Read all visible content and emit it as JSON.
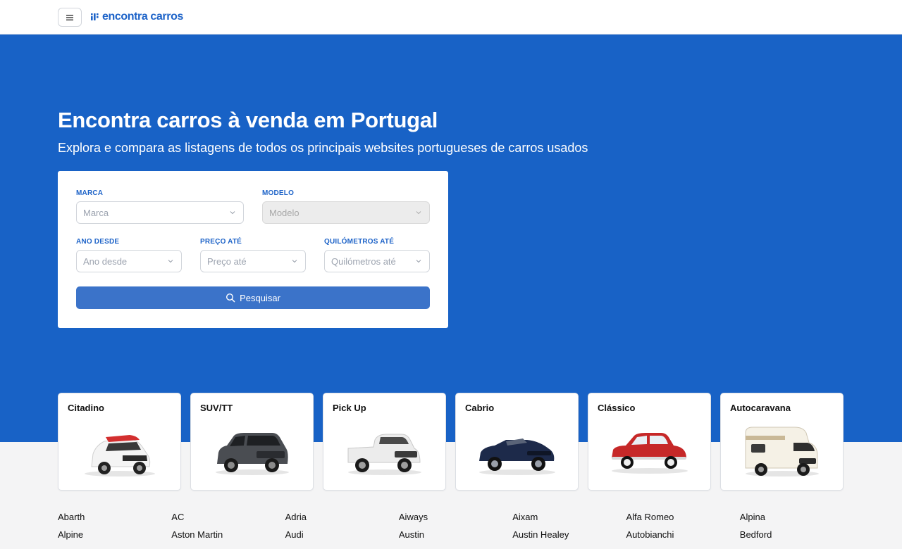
{
  "header": {
    "logo_text": "encontra carros",
    "menu_icon": "hamburger-icon",
    "brand_color": "#1d63c8"
  },
  "hero": {
    "title": "Encontra carros à venda em Portugal",
    "subtitle": "Explora e compara as listagens de todos os principais websites portugueses de carros usados",
    "background": "#1862c6"
  },
  "search": {
    "marca_label": "MARCA",
    "marca_placeholder": "Marca",
    "modelo_label": "MODELO",
    "modelo_placeholder": "Modelo",
    "ano_label": "ANO DESDE",
    "ano_placeholder": "Ano desde",
    "preco_label": "PREÇO ATÉ",
    "preco_placeholder": "Preço até",
    "km_label": "QUILÓMETROS ATÉ",
    "km_placeholder": "Quilómetros até",
    "button_label": "Pesquisar"
  },
  "categories": [
    {
      "label": "Citadino",
      "icon": "city-car-icon",
      "color": "#f2f2f2",
      "accent": "#d32f2f"
    },
    {
      "label": "SUV/TT",
      "icon": "suv-icon",
      "color": "#4a4d52",
      "accent": "#2f3135"
    },
    {
      "label": "Pick Up",
      "icon": "pickup-icon",
      "color": "#e9e9e9",
      "accent": "#bdbdbd"
    },
    {
      "label": "Cabrio",
      "icon": "cabrio-icon",
      "color": "#1d2a4a",
      "accent": "#111827"
    },
    {
      "label": "Clássico",
      "icon": "classic-car-icon",
      "color": "#c62828",
      "accent": "#8e1b1b"
    },
    {
      "label": "Autocaravana",
      "icon": "motorhome-icon",
      "color": "#f5f1e6",
      "accent": "#c9b896"
    }
  ],
  "brands": [
    "Abarth",
    "AC",
    "Adria",
    "Aiways",
    "Aixam",
    "Alfa Romeo",
    "Alpina",
    "Alpine",
    "Aston Martin",
    "Audi",
    "Austin",
    "Austin Healey",
    "Autobianchi",
    "Bedford"
  ]
}
